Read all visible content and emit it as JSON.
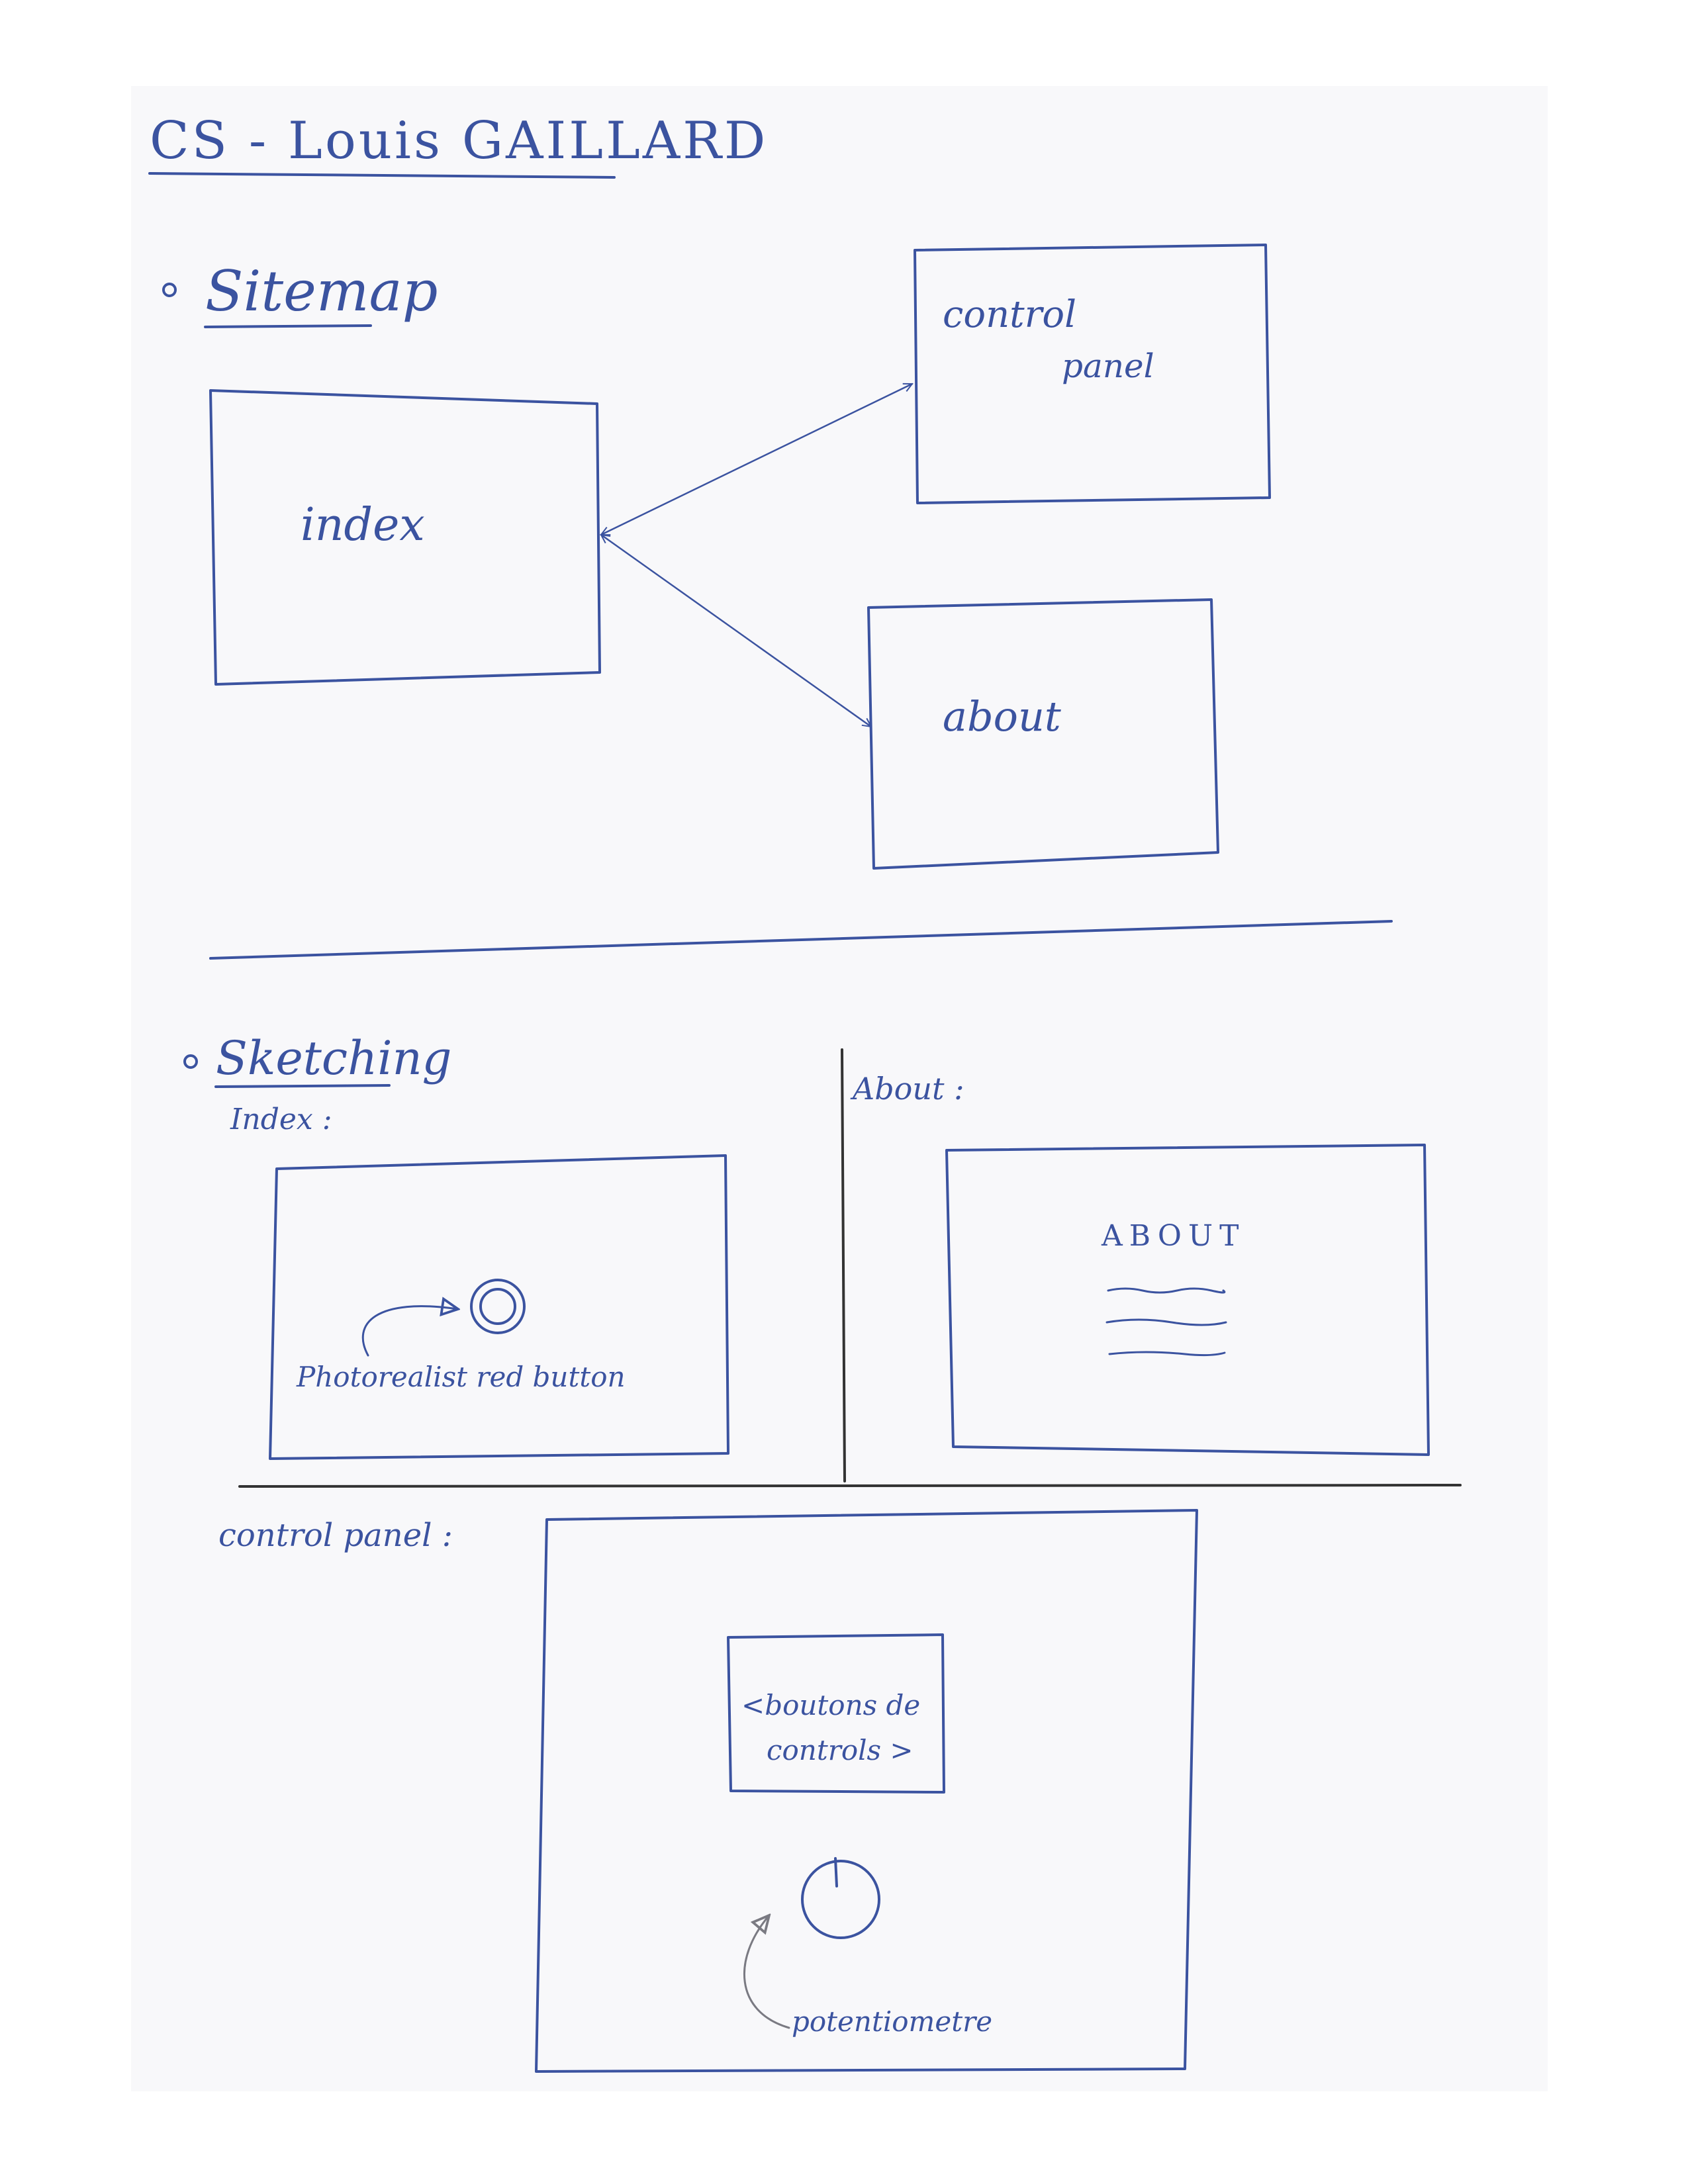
{
  "page": {
    "title": "CS - Louis GAILLARD",
    "ink_color": "#3b53a0",
    "paper_color": "#f8f8fa",
    "background_color": "#ffffff"
  },
  "sitemap": {
    "heading": "Sitemap",
    "nodes": [
      {
        "id": "index",
        "label": "index"
      },
      {
        "id": "control_panel",
        "label_line1": "control",
        "label_line2": "panel"
      },
      {
        "id": "about",
        "label": "about"
      }
    ],
    "edges": [
      {
        "from": "index",
        "to": "control_panel",
        "direction": "both"
      },
      {
        "from": "index",
        "to": "about",
        "direction": "both"
      }
    ]
  },
  "sketching": {
    "heading": "Sketching",
    "index": {
      "label": "Index :",
      "annotation": "Photorealist red button"
    },
    "about": {
      "label": "About :",
      "heading": "ABOUT",
      "text_lines": 3
    },
    "control_panel": {
      "label": "control panel :",
      "box_line1": "<boutons de",
      "box_line2": "controls >",
      "annotation": "potentiometre"
    }
  }
}
